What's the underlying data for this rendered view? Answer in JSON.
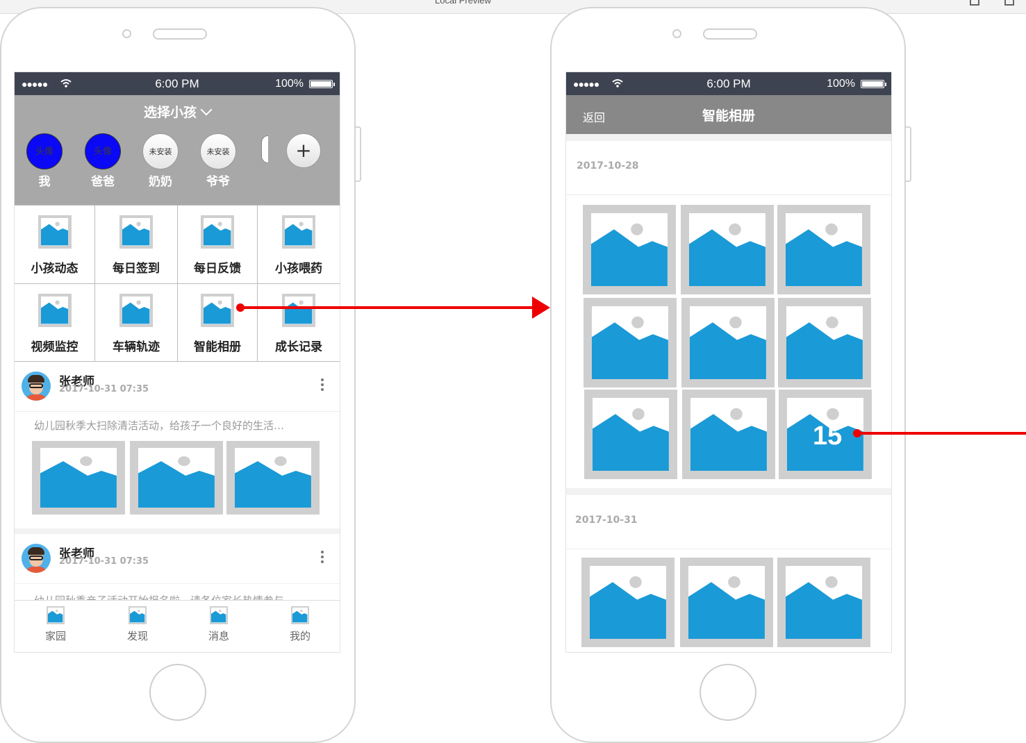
{
  "window": {
    "title": "Local Preview"
  },
  "status_bar": {
    "signal": "●●●●●",
    "time": "6:00 PM",
    "battery": "100%"
  },
  "home_screen": {
    "header_title": "选择小孩",
    "kids": [
      {
        "avatar_text": "头像",
        "name": "我"
      },
      {
        "avatar_text": "头像",
        "name": "爸爸"
      },
      {
        "avatar_text": "未安装",
        "name": "奶奶"
      },
      {
        "avatar_text": "未安装",
        "name": "爷爷"
      }
    ],
    "add_label": "+",
    "features": [
      {
        "label": "小孩动态"
      },
      {
        "label": "每日签到"
      },
      {
        "label": "每日反馈"
      },
      {
        "label": "小孩喂药"
      },
      {
        "label": "视频监控"
      },
      {
        "label": "车辆轨迹"
      },
      {
        "label": "智能相册"
      },
      {
        "label": "成长记录"
      }
    ],
    "posts": [
      {
        "author": "张老师",
        "time": "2017-10-31 07:35",
        "text": "幼儿园秋季大扫除清洁活动，给孩子一个良好的生活…"
      },
      {
        "author": "张老师",
        "time": "2017-10-31 07:35",
        "text": "幼儿园秋季亲子活动开始报名啦，请各位家长热情参与…"
      }
    ],
    "tabs": [
      {
        "label": "家园"
      },
      {
        "label": "发现"
      },
      {
        "label": "消息"
      },
      {
        "label": "我的"
      }
    ]
  },
  "album_screen": {
    "back_label": "返回",
    "title": "智能相册",
    "groups": [
      {
        "date": "2017-10-28",
        "more_count": "15"
      },
      {
        "date": "2017-10-31"
      }
    ]
  },
  "colors": {
    "status_bar": "#3d4350",
    "header_gray": "#a8a8a8",
    "nav_gray": "#888888",
    "image_blue": "#1a9ad6",
    "arrow_red": "#ee0000",
    "avatar_blue": "#0a08f5"
  }
}
